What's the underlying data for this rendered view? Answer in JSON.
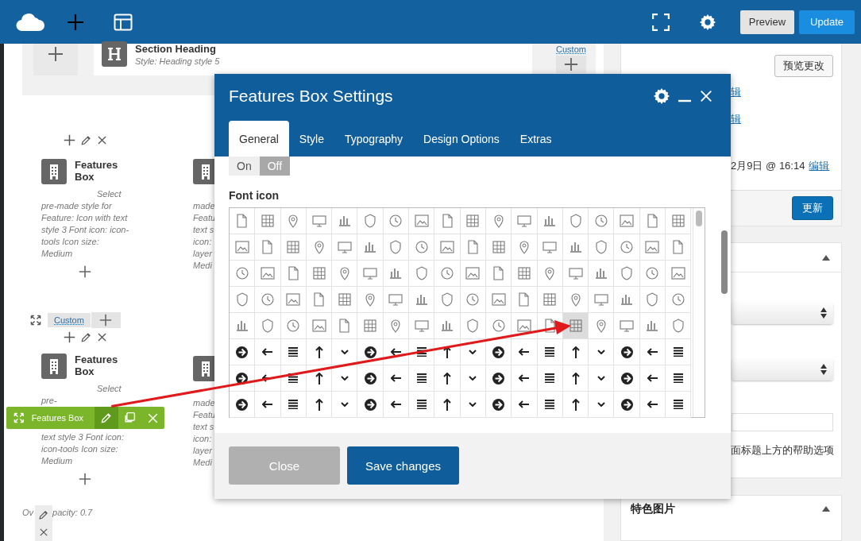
{
  "top_bar": {
    "buttons": [
      {
        "label": "Preview",
        "kind": "secondary"
      },
      {
        "label": "Update",
        "kind": "primary"
      }
    ]
  },
  "canvas": {
    "section_heading": {
      "title": "Section Heading",
      "subtitle": "Style: Heading style 5",
      "custom_link": "Custom"
    },
    "blocks": [
      {
        "title": "Features Box",
        "description": [
          "Select pre-made style for Feature: Icon with text style 3  Font icon: icon-tools  Icon size: Medium"
        ],
        "second_column": [
          "made",
          "Featu",
          "text s",
          "icon:",
          "layer",
          "Medi"
        ]
      },
      {
        "custom_link": "Custom",
        "title": "Features Box",
        "description": [
          "Select pre-",
          "text style 3  Font icon: icon-tools  Icon size: Medium"
        ],
        "toolbar": {
          "label": "Features Box"
        },
        "second_column": [
          "made",
          "Featu",
          "text s",
          "icon:",
          "layer",
          "Medi"
        ]
      }
    ],
    "footer_fragments": [
      "Ov",
      "pacity: 0.7"
    ]
  },
  "sidebar": {
    "preview_button": "预览更改",
    "links": [
      "辑",
      "辑"
    ],
    "date": "2月9日 @ 16:14",
    "date_link": "编辑",
    "update_button": "更新",
    "help_text": "面标题上方的帮助选项",
    "featured_image_title": "特色图片"
  },
  "modal": {
    "title": "Features Box Settings",
    "tabs": [
      {
        "label": "General",
        "selected": true
      },
      {
        "label": "Style",
        "selected": false
      },
      {
        "label": "Typography",
        "selected": false
      },
      {
        "label": "Design Options",
        "selected": false
      },
      {
        "label": "Extras",
        "selected": false
      }
    ],
    "toggle": [
      {
        "label": "On",
        "selected": false
      },
      {
        "label": "Off",
        "selected": true
      }
    ],
    "font_icon": {
      "label": "Font icon",
      "rows": [
        {
          "kind": "outline",
          "cells": [
            {
              "selected": false
            },
            {
              "selected": false
            },
            {
              "selected": false
            },
            {
              "selected": false
            },
            {
              "selected": false
            },
            {
              "selected": false
            },
            {
              "selected": false
            },
            {
              "selected": false
            },
            {
              "selected": false
            },
            {
              "selected": false
            },
            {
              "selected": false
            },
            {
              "selected": false
            },
            {
              "selected": false
            },
            {
              "selected": false
            },
            {
              "selected": false
            },
            {
              "selected": false
            },
            {
              "selected": false
            },
            {
              "selected": false
            }
          ]
        },
        {
          "kind": "outline",
          "cells": [
            {
              "selected": false
            },
            {
              "selected": false
            },
            {
              "selected": false
            },
            {
              "selected": false
            },
            {
              "selected": false
            },
            {
              "selected": false
            },
            {
              "selected": false
            },
            {
              "selected": false
            },
            {
              "selected": false
            },
            {
              "selected": false
            },
            {
              "selected": false
            },
            {
              "selected": false
            },
            {
              "selected": false
            },
            {
              "selected": false
            },
            {
              "selected": false
            },
            {
              "selected": false
            },
            {
              "selected": false
            },
            {
              "selected": false
            }
          ]
        },
        {
          "kind": "outline",
          "cells": [
            {
              "selected": false
            },
            {
              "selected": false
            },
            {
              "selected": false
            },
            {
              "selected": false
            },
            {
              "selected": false
            },
            {
              "selected": false
            },
            {
              "selected": false
            },
            {
              "selected": false
            },
            {
              "selected": false
            },
            {
              "selected": false
            },
            {
              "selected": false
            },
            {
              "selected": false
            },
            {
              "selected": false
            },
            {
              "selected": false
            },
            {
              "selected": false
            },
            {
              "selected": false
            },
            {
              "selected": false
            },
            {
              "selected": false
            }
          ]
        },
        {
          "kind": "outline",
          "cells": [
            {
              "selected": false
            },
            {
              "selected": false
            },
            {
              "selected": false
            },
            {
              "selected": false
            },
            {
              "selected": false
            },
            {
              "selected": false
            },
            {
              "selected": false
            },
            {
              "selected": false
            },
            {
              "selected": false
            },
            {
              "selected": false
            },
            {
              "selected": false
            },
            {
              "selected": false
            },
            {
              "selected": false
            },
            {
              "selected": false
            },
            {
              "selected": false
            },
            {
              "selected": false
            },
            {
              "selected": false
            },
            {
              "selected": false
            }
          ]
        },
        {
          "kind": "outline",
          "cells": [
            {
              "selected": false
            },
            {
              "selected": false
            },
            {
              "selected": false
            },
            {
              "selected": false
            },
            {
              "selected": false
            },
            {
              "selected": false
            },
            {
              "selected": false
            },
            {
              "selected": false
            },
            {
              "selected": false
            },
            {
              "selected": false
            },
            {
              "selected": false
            },
            {
              "selected": false
            },
            {
              "selected": false
            },
            {
              "selected": true
            },
            {
              "selected": false
            },
            {
              "selected": false
            },
            {
              "selected": false
            },
            {
              "selected": false
            }
          ]
        },
        {
          "kind": "solid",
          "cells": [
            {
              "selected": false
            },
            {
              "selected": false
            },
            {
              "selected": false
            },
            {
              "selected": false
            },
            {
              "selected": false
            },
            {
              "selected": false
            },
            {
              "selected": false
            },
            {
              "selected": false
            },
            {
              "selected": false
            },
            {
              "selected": false
            },
            {
              "selected": false
            },
            {
              "selected": false
            },
            {
              "selected": false
            },
            {
              "selected": false
            },
            {
              "selected": false
            },
            {
              "selected": false
            },
            {
              "selected": false
            },
            {
              "selected": false
            }
          ]
        },
        {
          "kind": "solid",
          "cells": [
            {
              "selected": false
            },
            {
              "selected": false
            },
            {
              "selected": false
            },
            {
              "selected": false
            },
            {
              "selected": false
            },
            {
              "selected": false
            },
            {
              "selected": false
            },
            {
              "selected": false
            },
            {
              "selected": false
            },
            {
              "selected": false
            },
            {
              "selected": false
            },
            {
              "selected": false
            },
            {
              "selected": false
            },
            {
              "selected": false
            },
            {
              "selected": false
            },
            {
              "selected": false
            },
            {
              "selected": false
            },
            {
              "selected": false
            }
          ]
        },
        {
          "kind": "solid",
          "cells": [
            {
              "selected": false
            },
            {
              "selected": false
            },
            {
              "selected": false
            },
            {
              "selected": false
            },
            {
              "selected": false
            },
            {
              "selected": false
            },
            {
              "selected": false
            },
            {
              "selected": false
            },
            {
              "selected": false
            },
            {
              "selected": false
            },
            {
              "selected": false
            },
            {
              "selected": false
            },
            {
              "selected": false
            },
            {
              "selected": false
            },
            {
              "selected": false
            },
            {
              "selected": false
            },
            {
              "selected": false
            },
            {
              "selected": false
            }
          ]
        }
      ]
    },
    "buttons": [
      {
        "label": "Close",
        "kind": "secondary"
      },
      {
        "label": "Save changes",
        "kind": "primary"
      }
    ]
  }
}
